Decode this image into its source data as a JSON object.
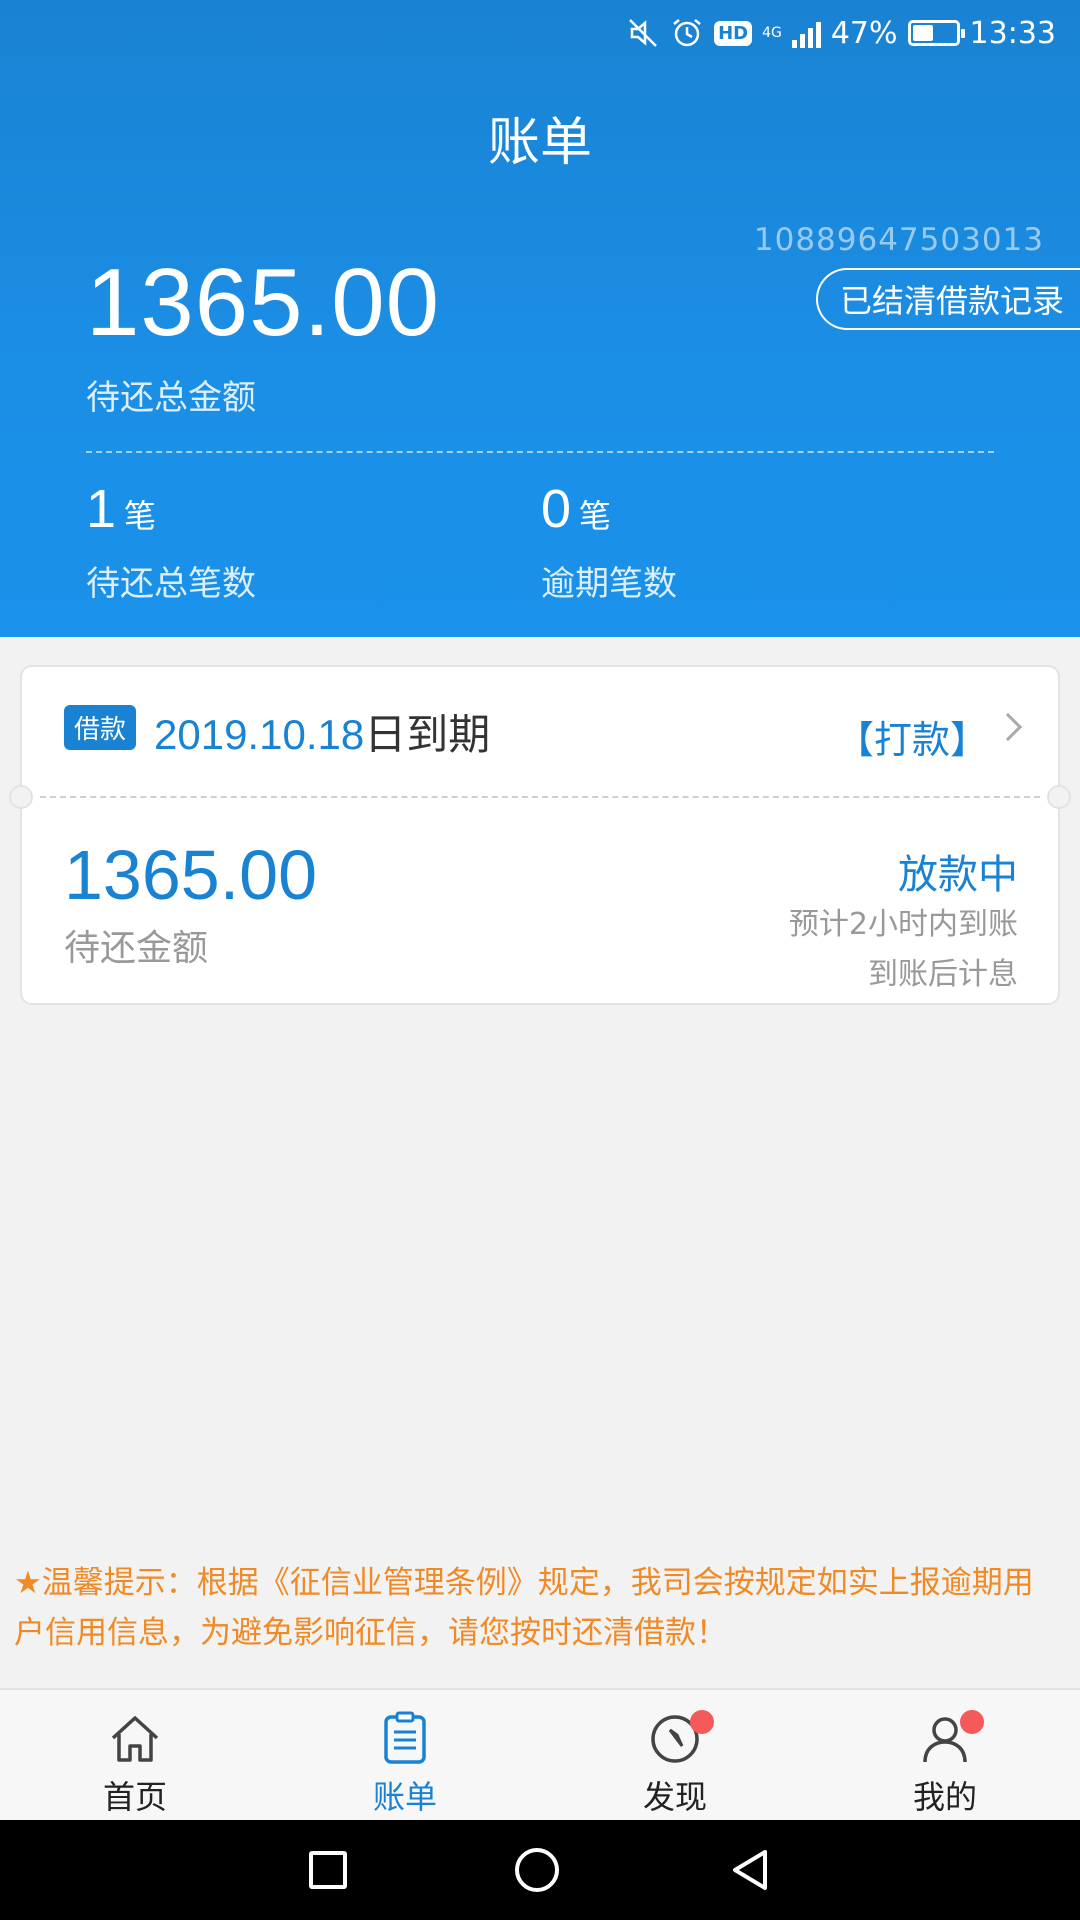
{
  "status_bar": {
    "battery": "47%",
    "battery_level": 0.47,
    "time": "13:33",
    "hd": "HD",
    "network": "4G"
  },
  "header": {
    "title": "账单",
    "account_number": "10889647503013",
    "records_button": "已结清借款记录",
    "total_amount": "1365.00",
    "total_label": "待还总金额",
    "pending_count": "1",
    "pending_unit": "笔",
    "pending_label": "待还总笔数",
    "overdue_count": "0",
    "overdue_unit": "笔",
    "overdue_label": "逾期笔数"
  },
  "loan_card": {
    "tag": "借款",
    "due_date": "2019.10.18",
    "due_suffix": "日到期",
    "action": "【打款】",
    "amount": "1365.00",
    "amount_label": "待还金额",
    "status": "放款中",
    "note1": "预计2小时内到账",
    "note2": "到账后计息"
  },
  "notice": "★温馨提示：根据《征信业管理条例》规定，我司会按规定如实上报逾期用户信用信息，为避免影响征信，请您按时还清借款！",
  "tabs": [
    {
      "label": "首页",
      "icon": "home-icon",
      "active": false
    },
    {
      "label": "账单",
      "icon": "bill-icon",
      "active": true
    },
    {
      "label": "发现",
      "icon": "compass-icon",
      "active": false
    },
    {
      "label": "我的",
      "icon": "user-icon",
      "active": false
    }
  ],
  "colors": {
    "primary": "#1a82d2",
    "notice": "#f08a24",
    "badge": "#f55a5a"
  }
}
